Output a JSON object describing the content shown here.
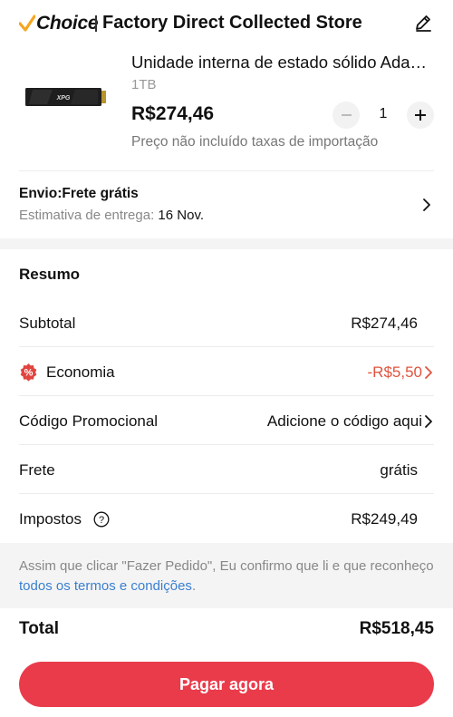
{
  "header": {
    "choice_label": "Choice",
    "store_name": "Factory Direct Collected Store",
    "icons": {
      "edit": "pencil-icon",
      "choice": "checkmark-icon"
    }
  },
  "product": {
    "title": "Unidade interna de estado sólido Ada…",
    "variant": "1TB",
    "price": "R$274,46",
    "quantity": "1",
    "import_note": "Preço não incluído taxas de importação",
    "image": "ssd-product-image"
  },
  "shipping": {
    "title": "Envio:Frete grátis",
    "estimate_label": "Estimativa de entrega: ",
    "estimate_date": "16 Nov."
  },
  "summary": {
    "title": "Resumo",
    "rows": [
      {
        "label": "Subtotal",
        "value": "R$274,46"
      },
      {
        "label": "Economia",
        "value": "-R$5,50"
      },
      {
        "label": "Código Promocional",
        "value": "Adicione o código aqui"
      },
      {
        "label": "Frete",
        "value": "grátis"
      },
      {
        "label": "Impostos",
        "value": "R$249,49"
      }
    ]
  },
  "terms": {
    "text": "Assim que clicar \"Fazer Pedido\", Eu confirmo que li e que reconheço ",
    "link": "todos os termos e condições",
    "suffix": "."
  },
  "footer": {
    "total_label": "Total",
    "total_value": "R$518,45",
    "pay_label": "Pagar agora"
  },
  "colors": {
    "accent": "#ea3b4b",
    "discount": "#e0533f",
    "link": "#3a7fd0",
    "choice_check": "#f5a623"
  }
}
